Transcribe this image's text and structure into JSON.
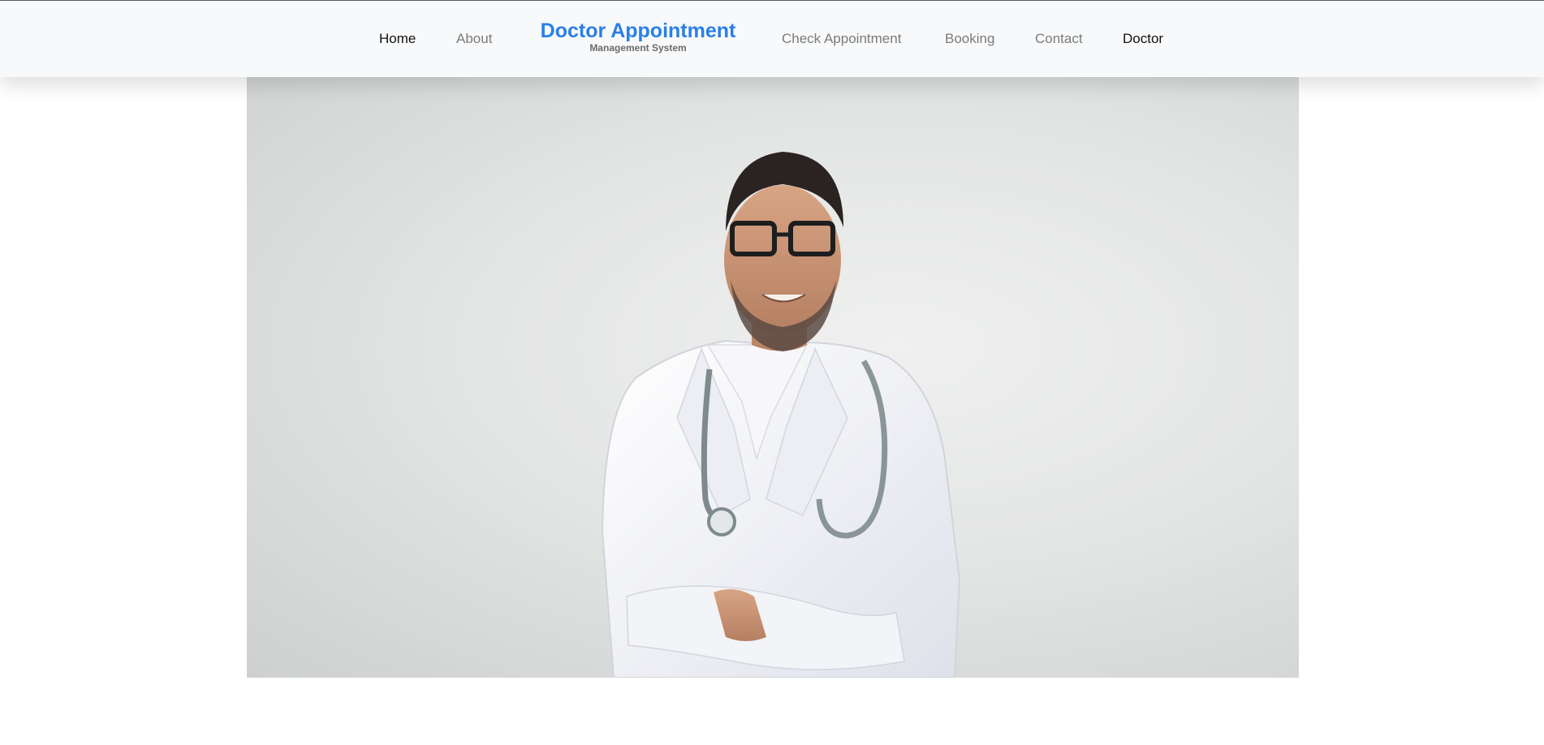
{
  "nav": {
    "home": "Home",
    "about": "About",
    "brand_title": "Doctor Appointment",
    "brand_subtitle": "Management System",
    "check_appointment": "Check Appointment",
    "booking": "Booking",
    "contact": "Contact",
    "doctor": "Doctor"
  },
  "colors": {
    "brand": "#2a7fe8",
    "nav_background": "#f8f9fa",
    "active_link": "#111111",
    "muted_link": "#7b7b7b"
  },
  "hero": {
    "image": "doctor-portrait"
  }
}
